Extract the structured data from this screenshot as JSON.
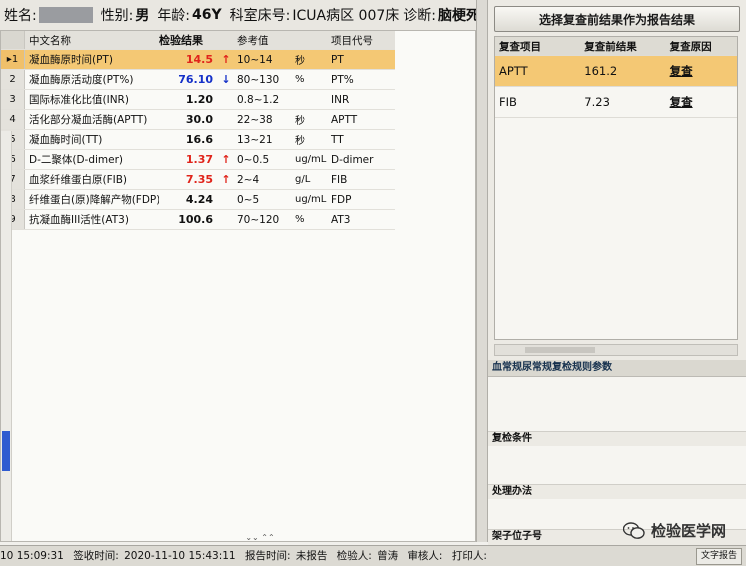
{
  "patient_bar": {
    "name_label": "姓名:",
    "sex_label": "性别:",
    "sex": "男",
    "age_label": "年龄:",
    "age": "46Y",
    "dept_label": "科室床号:",
    "dept": "ICUA病区 007床",
    "diagnosis_label": "诊断:",
    "diagnosis": "脑梗死"
  },
  "results_table": {
    "headers": [
      "中文名称",
      "检验结果",
      "参考值",
      "项目代号"
    ],
    "rows": [
      {
        "no": "1",
        "name": "凝血酶原时间(PT)",
        "result": "14.5",
        "flag": "↑",
        "ref": "10~14",
        "unit": "秒",
        "code": "PT",
        "status": "high"
      },
      {
        "no": "2",
        "name": "凝血酶原活动度(PT%)",
        "result": "76.10",
        "flag": "↓",
        "ref": "80~130",
        "unit": "%",
        "code": "PT%",
        "status": "low"
      },
      {
        "no": "3",
        "name": "国际标准化比值(INR)",
        "result": "1.20",
        "flag": "",
        "ref": "0.8~1.2",
        "unit": "",
        "code": "INR",
        "status": "normal"
      },
      {
        "no": "4",
        "name": "活化部分凝血活酶(APTT)",
        "result": "30.0",
        "flag": "",
        "ref": "22~38",
        "unit": "秒",
        "code": "APTT",
        "status": "normal"
      },
      {
        "no": "5",
        "name": "凝血酶时间(TT)",
        "result": "16.6",
        "flag": "",
        "ref": "13~21",
        "unit": "秒",
        "code": "TT",
        "status": "normal"
      },
      {
        "no": "6",
        "name": "D-二聚体(D-dimer)",
        "result": "1.37",
        "flag": "↑",
        "ref": "0~0.5",
        "unit": "ug/mL",
        "code": "D-dimer",
        "status": "high"
      },
      {
        "no": "7",
        "name": "血浆纤维蛋白原(FIB)",
        "result": "7.35",
        "flag": "↑",
        "ref": "2~4",
        "unit": "g/L",
        "code": "FIB",
        "status": "high"
      },
      {
        "no": "8",
        "name": "纤维蛋白(原)降解产物(FDP)",
        "result": "4.24",
        "flag": "",
        "ref": "0~5",
        "unit": "ug/mL",
        "code": "FDP",
        "status": "normal"
      },
      {
        "no": "9",
        "name": "抗凝血酶III活性(AT3)",
        "result": "100.6",
        "flag": "",
        "ref": "70~120",
        "unit": "%",
        "code": "AT3",
        "status": "normal"
      }
    ]
  },
  "right_panel": {
    "select_button": "选择复查前结果作为报告结果",
    "headers": [
      "复查项目",
      "复查前结果",
      "复查原因"
    ],
    "rows": [
      {
        "item": "APTT",
        "before": "161.2",
        "reason": "复查"
      },
      {
        "item": "FIB",
        "before": "7.23",
        "reason": "复查"
      }
    ],
    "param_title": "血常规尿常规复检规则参数",
    "recheck_condition": "复检条件",
    "method": "处理办法",
    "rack_label": "架子位子号"
  },
  "status_bar": {
    "time_start": "10 15:09:31",
    "sign_label": "签收时间:",
    "sign_time": "2020-11-10 15:43:11",
    "report_label": "报告时间:",
    "report_value": "未报告",
    "inspector_label": "检验人:",
    "inspector": "曾涛",
    "reviewer_label": "审核人:",
    "printer_label": "打印人:",
    "text_report_btn": "文字报告"
  },
  "watermark": {
    "text": "检验医学网"
  },
  "colors": {
    "selected_row": "#f4c874",
    "high_flag": "#e0241b",
    "low_flag": "#1430c8"
  }
}
